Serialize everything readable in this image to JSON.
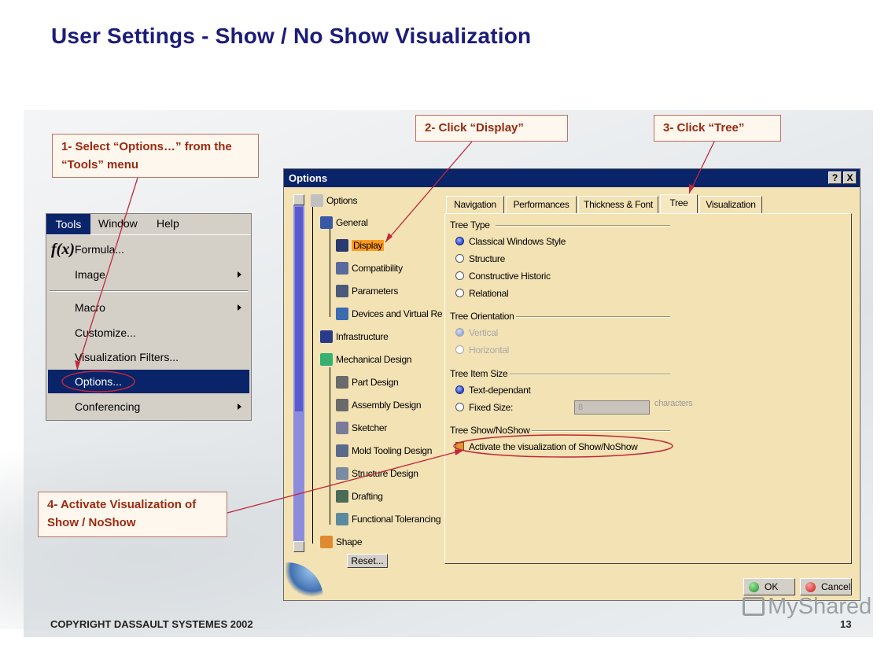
{
  "title": "User Settings - Show / No Show Visualization",
  "callouts": {
    "step1": "1- Select “Options…” from the “Tools” menu",
    "step2": "2- Click “Display”",
    "step3": "3- Click “Tree”",
    "step4": "4- Activate Visualization of Show / NoShow"
  },
  "menu": {
    "bar": [
      "Tools",
      "Window",
      "Help"
    ],
    "items": [
      "Formula...",
      "Image",
      "Macro",
      "Customize...",
      "Visualization Filters...",
      "Options...",
      "Conferencing"
    ],
    "selected": "Options..."
  },
  "dialog": {
    "title": "Options",
    "help_btn": "?",
    "close_btn": "X",
    "tree": {
      "root": "Options",
      "general": "General",
      "display": "Display",
      "compatibility": "Compatibility",
      "parameters": "Parameters",
      "devices": "Devices and Virtual Re",
      "infrastructure": "Infrastructure",
      "mechanical": "Mechanical Design",
      "part": "Part Design",
      "assembly": "Assembly Design",
      "sketcher": "Sketcher",
      "mold": "Mold Tooling Design",
      "structure": "Structure Design",
      "drafting": "Drafting",
      "functional": "Functional Tolerancing",
      "shape": "Shape"
    },
    "reset": "Reset...",
    "tabs": [
      "Navigation",
      "Performances",
      "Thickness & Font",
      "Tree",
      "Visualization"
    ],
    "active_tab": "Tree",
    "tree_type": {
      "label": "Tree Type",
      "options": [
        "Classical Windows Style",
        "Structure",
        "Constructive Historic",
        "Relational"
      ],
      "selected": "Classical Windows Style"
    },
    "tree_orientation": {
      "label": "Tree Orientation",
      "options": [
        "Vertical",
        "Horizontal"
      ],
      "selected": "Vertical"
    },
    "tree_item_size": {
      "label": "Tree Item Size",
      "options": [
        "Text-dependant",
        "Fixed Size:"
      ],
      "selected": "Text-dependant",
      "fixed_value": "8",
      "unit": "characters"
    },
    "tree_show": {
      "label": "Tree Show/NoShow",
      "checkbox": "Activate the visualization of Show/NoShow",
      "checked": true
    },
    "ok": "OK",
    "cancel": "Cancel"
  },
  "footer": {
    "copyright": "COPYRIGHT DASSAULT SYSTEMES 2002",
    "page": "13"
  },
  "watermark": "MyShared",
  "colors": {
    "title": "#1c1c7a",
    "callout_text": "#9b2a10",
    "selection": "#0a246a",
    "dialog_bg": "#f3e2b4",
    "highlight": "#ff9a1e",
    "annotation_line": "#c0283a"
  }
}
